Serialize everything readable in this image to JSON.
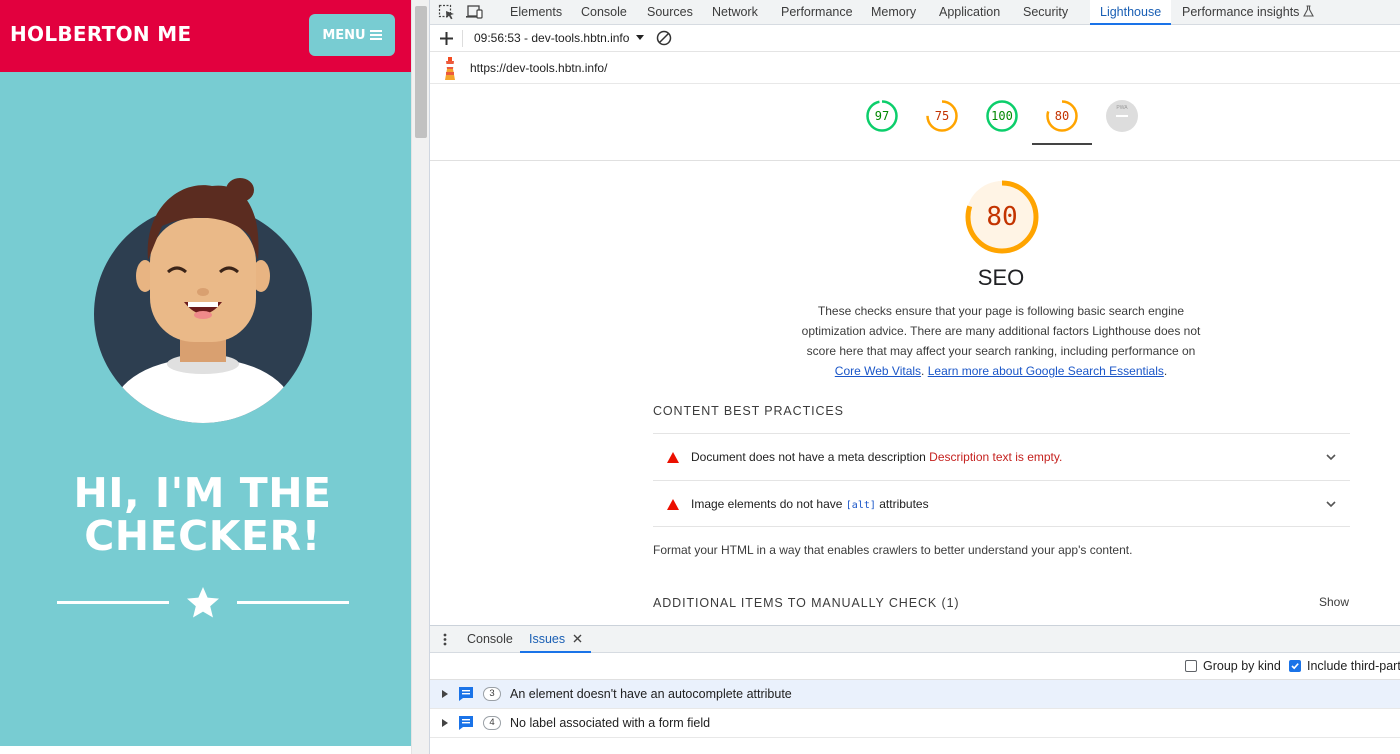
{
  "site": {
    "title": "HOLBERTON ME",
    "menu_label": "MENU",
    "hero_line1": "HI, I'M THE",
    "hero_line2": "CHECKER!"
  },
  "devtools": {
    "tabs": [
      "Elements",
      "Console",
      "Sources",
      "Network",
      "Performance",
      "Memory",
      "Application",
      "Security",
      "Lighthouse",
      "Performance insights"
    ],
    "active_tab": "Lighthouse",
    "report_selector": "09:56:53 - dev-tools.hbtn.info",
    "url": "https://dev-tools.hbtn.info/"
  },
  "scores": [
    {
      "value": "97",
      "status": "pass"
    },
    {
      "value": "75",
      "status": "average"
    },
    {
      "value": "100",
      "status": "pass"
    },
    {
      "value": "80",
      "status": "average"
    },
    {
      "value": "PWA",
      "status": "na"
    }
  ],
  "category": {
    "score": "80",
    "title": "SEO",
    "desc_line1": "These checks ensure that your page is following basic search engine",
    "desc_line2": "optimization advice. There are many additional factors Lighthouse does not",
    "desc_line3": "score here that may affect your search ranking, including performance on",
    "link1": "Core Web Vitals",
    "sep": ". ",
    "link2": "Learn more about Google Search Essentials",
    "end": "."
  },
  "content_group": {
    "heading": "CONTENT BEST PRACTICES",
    "audits": [
      {
        "title": "Document does not have a meta description",
        "warning": "Description text is empty."
      },
      {
        "title_pre": "Image elements do not have",
        "code": "[alt]",
        "title_post": "attributes"
      }
    ],
    "description": "Format your HTML in a way that enables crawlers to better understand your app's content."
  },
  "manual_group": {
    "heading": "ADDITIONAL ITEMS TO MANUALLY CHECK (1)",
    "show_label": "Show"
  },
  "drawer": {
    "tabs": [
      "Console",
      "Issues"
    ],
    "active_tab": "Issues",
    "group_by_kind": "Group by kind",
    "include_third_party": "Include third-part",
    "issues": [
      {
        "count": "3",
        "text": "An element doesn't have an autocomplete attribute"
      },
      {
        "count": "4",
        "text": "No label associated with a form field"
      }
    ]
  },
  "colors": {
    "header_red": "#e2003e",
    "teal": "#78ccd2",
    "pass_green": "#0cce6b",
    "average_orange": "#ffa400",
    "link_blue": "#1a56c8"
  }
}
